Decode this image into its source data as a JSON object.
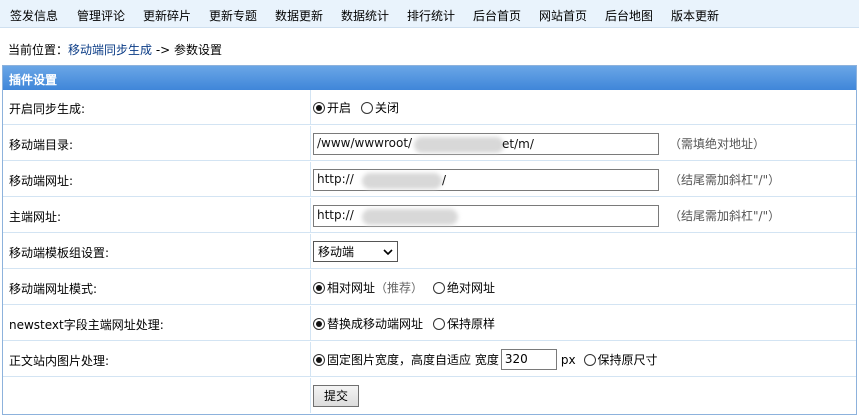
{
  "topnav": [
    "签发信息",
    "管理评论",
    "更新碎片",
    "更新专题",
    "数据更新",
    "数据统计",
    "排行统计",
    "后台首页",
    "网站首页",
    "后台地图",
    "版本更新"
  ],
  "breadcrumb": {
    "prefix": "当前位置：",
    "link": "移动端同步生成",
    "suffix": " -> 参数设置"
  },
  "panel": {
    "title": "插件设置"
  },
  "form": {
    "sync": {
      "label": "开启同步生成:",
      "on": "开启",
      "off": "关闭",
      "selected": "on"
    },
    "dir": {
      "label": "移动端目录:",
      "value_start": "/www/wwwroot/",
      "value_end": "et/m/",
      "hint": "（需填绝对地址）"
    },
    "mobile_url": {
      "label": "移动端网址:",
      "value_start": "http://",
      "value_end": "/",
      "hint": "（结尾需加斜杠\"/\"）"
    },
    "main_url": {
      "label": "主端网址:",
      "value_start": "http://",
      "value_end": "",
      "hint": "（结尾需加斜杠\"/\"）"
    },
    "template": {
      "label": "移动端模板组设置:",
      "value": "移动端"
    },
    "url_mode": {
      "label": "移动端网址模式:",
      "relative": "相对网址",
      "recommend": "（推荐）",
      "absolute": "绝对网址",
      "selected": "relative"
    },
    "newstext": {
      "label": "newstext字段主端网址处理:",
      "replace": "替换成移动端网址",
      "keep": "保持原样",
      "selected": "replace"
    },
    "image": {
      "label": "正文站内图片处理:",
      "fixed": "固定图片宽度，高度自适应 宽度",
      "width": "320",
      "unit": "px",
      "keep": "保持原尺寸",
      "selected": "fixed"
    }
  },
  "submit_label": "提交"
}
